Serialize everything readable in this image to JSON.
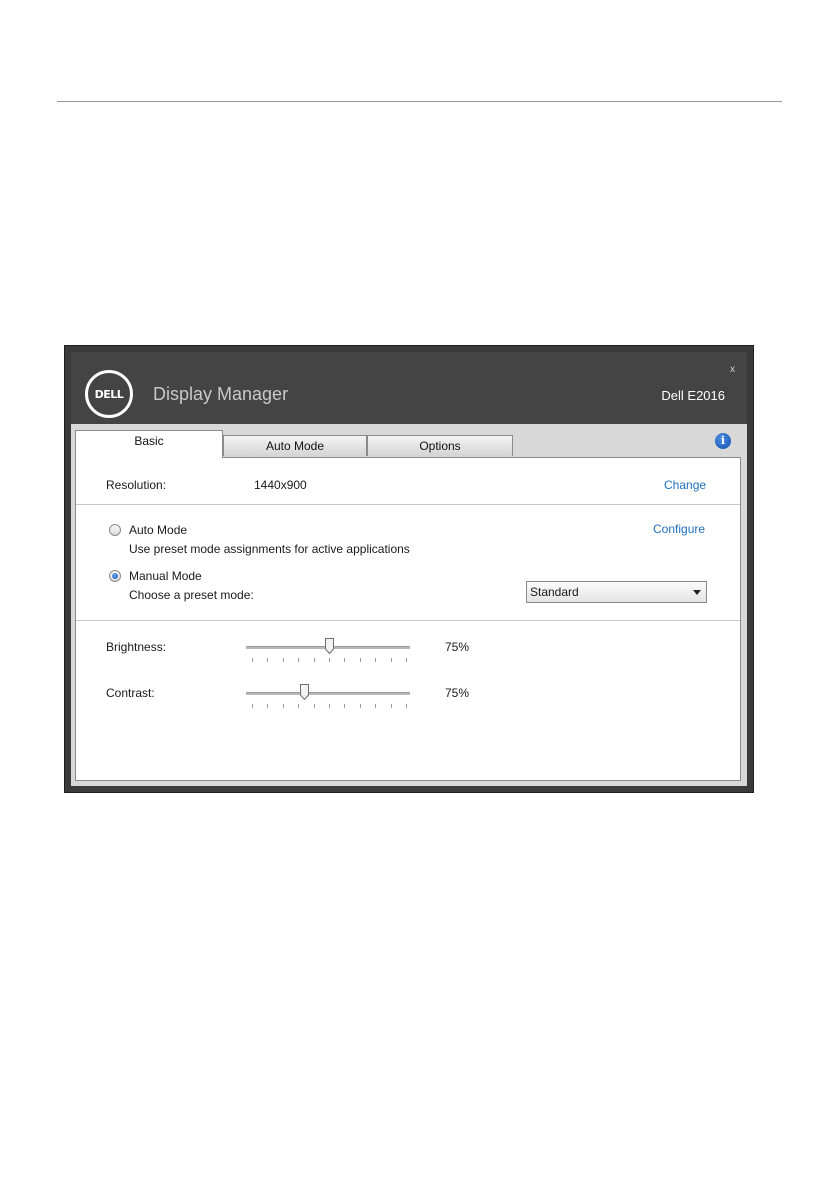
{
  "window": {
    "app_title": "Display Manager",
    "model_name": "Dell E2016",
    "close_label": "x",
    "logo_text": "DELL"
  },
  "tabs": [
    {
      "label": "Basic",
      "active": true
    },
    {
      "label": "Auto Mode",
      "active": false
    },
    {
      "label": "Options",
      "active": false
    }
  ],
  "info_icon_glyph": "i",
  "resolution": {
    "label": "Resolution:",
    "value": "1440x900",
    "change_link": "Change"
  },
  "modes": {
    "configure_link": "Configure",
    "auto": {
      "label": "Auto Mode",
      "description": "Use preset mode assignments for active applications",
      "selected": false
    },
    "manual": {
      "label": "Manual Mode",
      "description": "Choose a preset mode:",
      "selected": true
    },
    "preset_select": {
      "value": "Standard"
    }
  },
  "brightness": {
    "label": "Brightness:",
    "value_text": "75%",
    "level": 0.5
  },
  "contrast": {
    "label": "Contrast:",
    "value_text": "75%",
    "level": 0.34
  },
  "colors": {
    "titlebar": "#444444",
    "link": "#1e6fbf",
    "radio_selected": "#1858b8"
  }
}
